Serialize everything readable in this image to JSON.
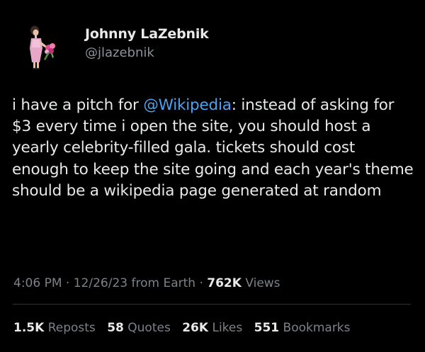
{
  "author": {
    "display_name": "Johnny LaZebnik",
    "handle": "@jlazebnik",
    "avatar_icon": "figure-with-pink-dress-and-flowers-icon"
  },
  "tweet": {
    "text_before_mention": "i have a pitch for ",
    "mention": "@Wikipedia",
    "text_after_mention": ": instead of asking for $3 every time i open the site, you should host a yearly celebrity-filled gala. tickets should cost enough to keep the site going and each year's theme should be a wikipedia page generated at random"
  },
  "meta": {
    "time": "4:06 PM",
    "sep1": " · ",
    "date": "12/26/23",
    "source": " from Earth",
    "sep2": " · ",
    "views_count": "762K",
    "views_label": " Views"
  },
  "stats": [
    {
      "count": "1.5K",
      "label": " Reposts"
    },
    {
      "count": "58",
      "label": " Quotes"
    },
    {
      "count": "26K",
      "label": " Likes"
    },
    {
      "count": "551",
      "label": " Bookmarks"
    }
  ],
  "colors": {
    "background": "#000000",
    "text": "#e7e9ea",
    "secondary": "#7b8289",
    "link": "#4ea3ee",
    "divider": "#2f3336"
  }
}
